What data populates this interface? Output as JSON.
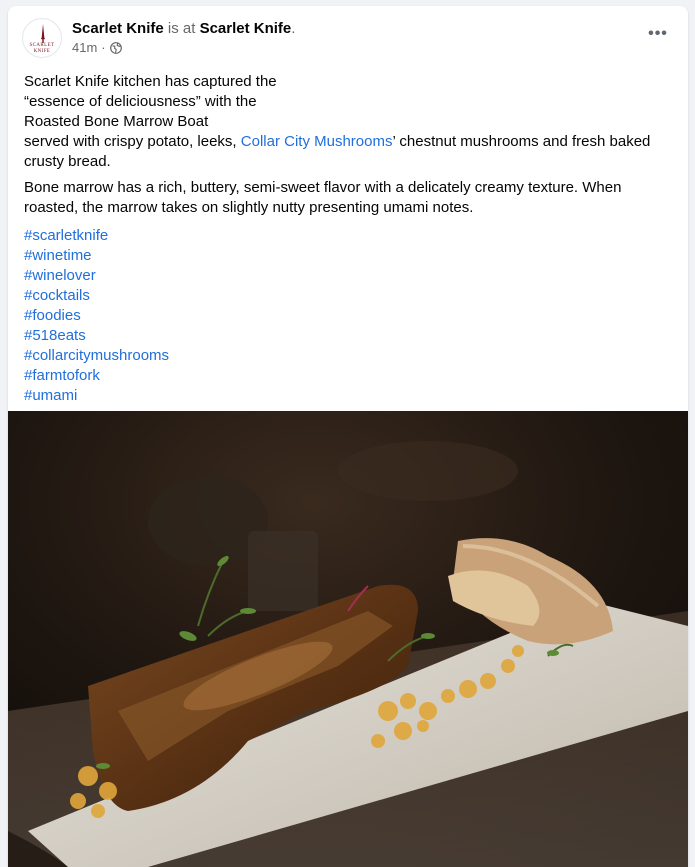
{
  "post": {
    "author": "Scarlet Knife",
    "is_at_text": "is at",
    "place": "Scarlet Knife",
    "place_suffix": ".",
    "time": "41m",
    "separator": "·",
    "privacy_icon": "globe-icon",
    "more_icon": "ellipsis-icon",
    "more_label": "•••",
    "avatar_text_1": "SCARLET",
    "avatar_text_2": "KNIFE",
    "line1": "Scarlet Knife kitchen has captured the",
    "line2": "“essence of deliciousness” with the",
    "line3": "Roasted Bone Marrow Boat",
    "line4_a": "served with crispy potato, leeks, ",
    "line4_link": "Collar City Mushrooms",
    "line4_b": "’ chestnut mushrooms and fresh baked crusty bread.",
    "paragraph2": "Bone marrow has a rich, buttery, semi-sweet flavor with a delicately creamy texture. When roasted, the marrow takes on slightly nutty presenting umami notes.",
    "hashtags": [
      "#scarletknife",
      "#winetime",
      "#winelover",
      "#cocktails",
      "#foodies",
      "#518eats",
      "#collarcitymushrooms",
      "#farmtofork",
      "#umami"
    ]
  },
  "colors": {
    "link": "#216fdb",
    "muted": "#65676b",
    "background": "#f0f2f5",
    "brand": "#7a1420"
  }
}
